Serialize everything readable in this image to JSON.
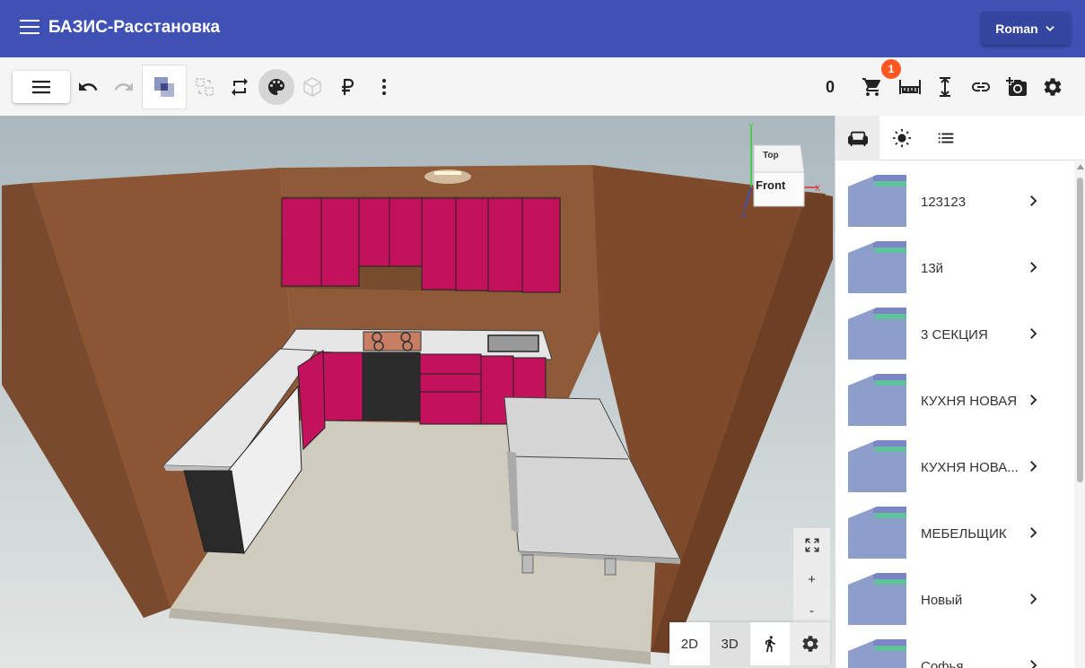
{
  "app": {
    "title": "БАЗИС-Расстановка",
    "user": "Roman"
  },
  "toolbar": {
    "cart_count": "0",
    "notification_badge": "1",
    "icons": [
      "menu-icon",
      "undo-icon",
      "redo-icon",
      "layers-icon",
      "swap-icon",
      "repeat-icon",
      "palette-icon",
      "cube-icon",
      "ruble-icon",
      "more-vert-icon",
      "cart-icon",
      "measure-icon",
      "height-icon",
      "link-icon",
      "camera-add-icon",
      "settings-icon"
    ]
  },
  "viewcube": {
    "top": "Top",
    "front": "Front",
    "axis_x": "X",
    "axis_y": "Y",
    "axis_z": "Z"
  },
  "viewport_controls": {
    "zoom_in": "+",
    "zoom_out": "-",
    "mode_2d": "2D",
    "mode_3d": "3D",
    "active_mode": "3D"
  },
  "panel": {
    "tabs": [
      "sofa-icon",
      "sun-icon",
      "list-icon"
    ],
    "items": [
      {
        "label": "123123"
      },
      {
        "label": "13й"
      },
      {
        "label": "3 СЕКЦИЯ"
      },
      {
        "label": "КУХНЯ НОВАЯ"
      },
      {
        "label": "КУХНЯ НОВА..."
      },
      {
        "label": "МЕБЕЛЬЩИК"
      },
      {
        "label": "Новый"
      },
      {
        "label": "Софья"
      }
    ]
  },
  "colors": {
    "app_bar": "#3f51b5",
    "cabinet": "#c2125c",
    "wall": "#8a5634",
    "badge": "#ff5722",
    "folder": "#8d9ecb",
    "folder_accent": "#5fc39c"
  }
}
